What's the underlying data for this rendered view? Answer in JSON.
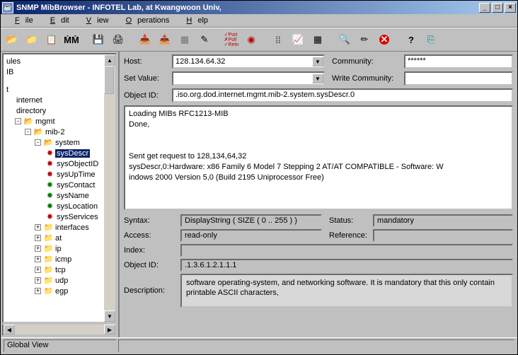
{
  "window": {
    "title": "SNMP MibBrowser - INFOTEL Lab, at Kwangwoon Univ,"
  },
  "menu": {
    "file": "File",
    "edit": "Edit",
    "view": "View",
    "operations": "Operations",
    "help": "Help"
  },
  "toolbar_icons": [
    "open-mib",
    "open-folder",
    "notes",
    "find",
    "",
    "save",
    "print",
    "",
    "req-get",
    "req-getnext",
    "req-getbulk",
    "req-set",
    "",
    "port-poll",
    "target",
    "",
    "chart-dots",
    "chart-line",
    "table",
    "",
    "doc-search",
    "edit-trap",
    "stop",
    "",
    "help",
    "exit"
  ],
  "tree": {
    "root_ules": "ules",
    "root_ib": "IB",
    "root_t": "t",
    "internet": "internet",
    "directory": "directory",
    "mgmt": "mgmt",
    "mib2": "mib-2",
    "system": "system",
    "sysDescr": "sysDescr",
    "sysObjectID": "sysObjectID",
    "sysUpTime": "sysUpTime",
    "sysContact": "sysContact",
    "sysName": "sysName",
    "sysLocation": "sysLocation",
    "sysServices": "sysServices",
    "interfaces": "interfaces",
    "at": "at",
    "ip": "ip",
    "icmp": "icmp",
    "tcp": "tcp",
    "udp": "udp",
    "egp": "egp"
  },
  "form": {
    "host_label": "Host:",
    "host_value": "128.134.64.32",
    "community_label": "Community:",
    "community_value": "******",
    "setvalue_label": "Set Value:",
    "setvalue_value": "",
    "wcommunity_label": "Write Community:",
    "wcommunity_value": "",
    "objectid_label": "Object ID:",
    "objectid_value": ".iso.org.dod.internet.mgmt.mib-2.system.sysDescr.0"
  },
  "output": {
    "l1": "Loading MIBs RFC1213-MIB",
    "l2": "Done,",
    "l3": "",
    "l4": "",
    "l5": "Sent get request to 128,134,64,32",
    "l6": "sysDescr,0:Hardware: x86 Family 6 Model 7 Stepping 2 AT/AT COMPATIBLE - Software: W",
    "l7": "indows 2000 Version 5,0 (Build 2195 Uniprocessor Free)"
  },
  "info": {
    "syntax_label": "Syntax:",
    "syntax_value": "DisplayString ( SIZE ( 0 .. 255 ) )",
    "status_label": "Status:",
    "status_value": "mandatory",
    "access_label": "Access:",
    "access_value": "read-only",
    "reference_label": "Reference:",
    "reference_value": "",
    "index_label": "Index:",
    "index_value": "",
    "oid_label": "Object ID:",
    "oid_value": ".1.3.6.1.2.1.1.1",
    "desc_label": "Description:",
    "desc_value": "software operating-system, and networking software.  It is mandatory that this only contain printable ASCII characters,"
  },
  "statusbar": {
    "text": "Global View"
  }
}
